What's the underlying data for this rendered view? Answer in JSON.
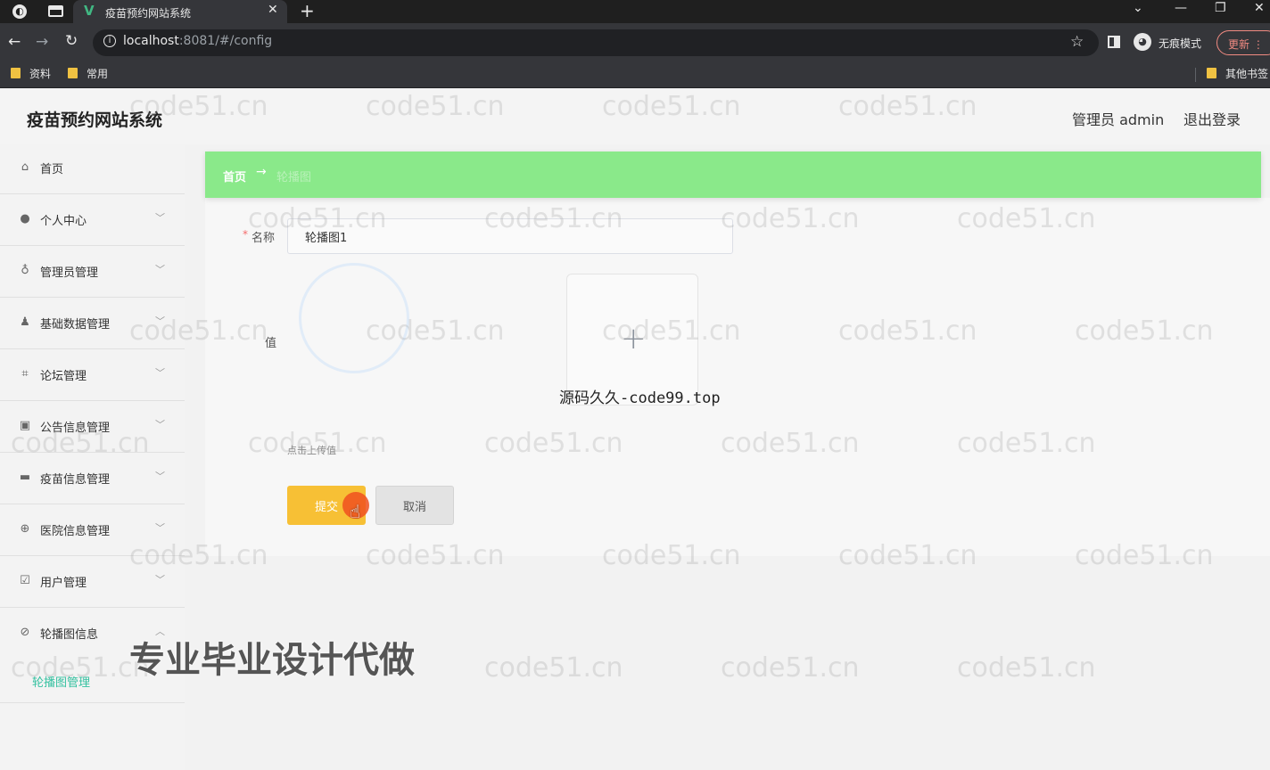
{
  "browser": {
    "tab_title": "疫苗预约网站系统",
    "tab_favicon": "V",
    "url_host": "localhost",
    "url_rest": ":8081/#/config",
    "incognito_label": "无痕模式",
    "update_label": "更新",
    "bookmarks": [
      "资料",
      "常用"
    ],
    "other_bookmarks": "其他书签"
  },
  "header": {
    "title": "疫苗预约网站系统",
    "user_role": "管理员 admin",
    "logout": "退出登录"
  },
  "sidebar": {
    "items": [
      {
        "label": "首页",
        "icon": "home-icon",
        "has_children": false
      },
      {
        "label": "个人中心",
        "icon": "user-icon",
        "has_children": true
      },
      {
        "label": "管理员管理",
        "icon": "microphone-icon",
        "has_children": true
      },
      {
        "label": "基础数据管理",
        "icon": "person-icon",
        "has_children": true
      },
      {
        "label": "论坛管理",
        "icon": "crop-icon",
        "has_children": true
      },
      {
        "label": "公告信息管理",
        "icon": "chart-icon",
        "has_children": true
      },
      {
        "label": "疫苗信息管理",
        "icon": "monitor-icon",
        "has_children": true
      },
      {
        "label": "医院信息管理",
        "icon": "target-icon",
        "has_children": true
      },
      {
        "label": "用户管理",
        "icon": "clipboard-icon",
        "has_children": true
      },
      {
        "label": "轮播图信息",
        "icon": "compass-icon",
        "has_children": true,
        "expanded": true
      }
    ],
    "submenu_active": "轮播图管理"
  },
  "breadcrumb": {
    "home": "首页",
    "arrow": "→",
    "current": "轮播图"
  },
  "form": {
    "name_label": "名称",
    "name_value": "轮播图1",
    "value_label": "值",
    "upload_hint": "点击上传值",
    "submit_label": "提交",
    "cancel_label": "取消"
  },
  "overlays": {
    "caption": "源码久久-code99.top",
    "promo": "专业毕业设计代做",
    "watermark": "code51.cn"
  },
  "colors": {
    "breadcrumb_bg": "#8ae98a",
    "submit_bg": "#f7c035",
    "submenu_active": "#34c1a0"
  }
}
